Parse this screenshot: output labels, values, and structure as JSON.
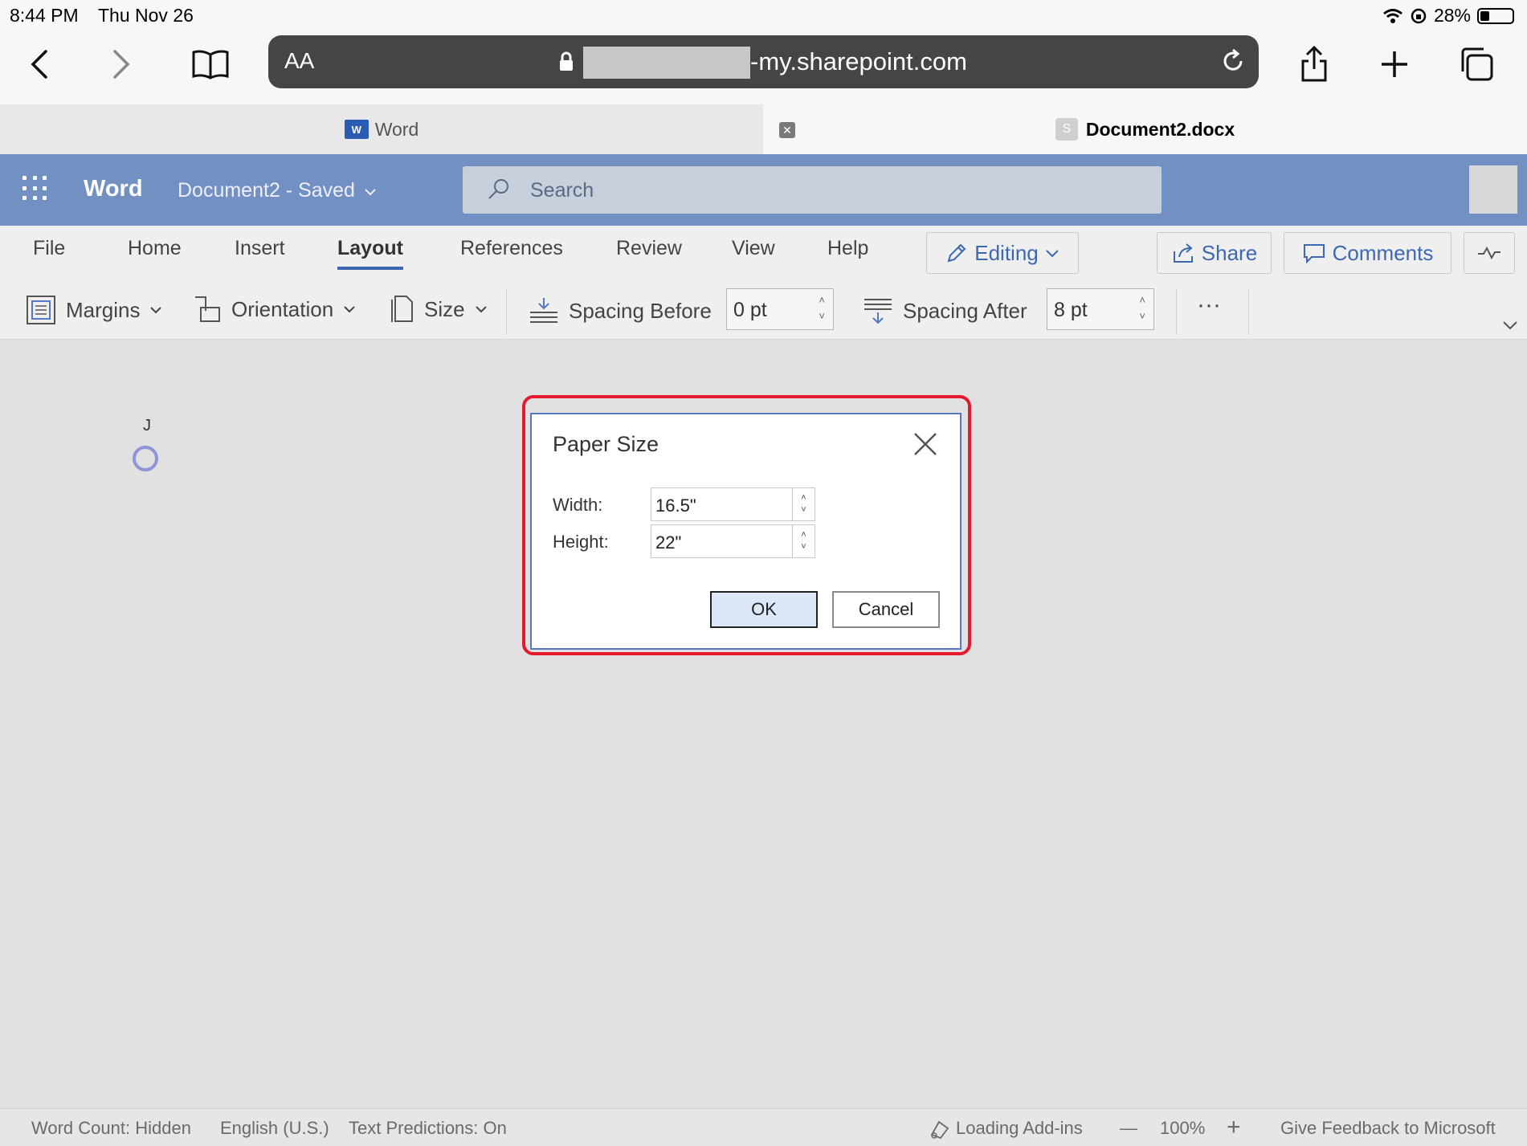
{
  "status_bar": {
    "time": "8:44 PM",
    "date": "Thu Nov 26",
    "battery": "28%"
  },
  "safari": {
    "text_size_label": "AA",
    "url_domain": "-my.sharepoint.com",
    "icons": [
      "back-icon",
      "forward-icon",
      "bookmarks-icon",
      "lock-icon",
      "reload-icon",
      "share-icon",
      "new-tab-icon",
      "tabs-icon"
    ]
  },
  "browser_tabs": [
    {
      "label": "Word",
      "active": false
    },
    {
      "label": "Document2.docx",
      "active": true
    }
  ],
  "word_header": {
    "app_name": "Word",
    "doc_title": "Document2  -  Saved",
    "search_placeholder": "Search"
  },
  "ribbon_tabs": [
    "File",
    "Home",
    "Insert",
    "Layout",
    "References",
    "Review",
    "View",
    "Help"
  ],
  "ribbon_active_tab": "Layout",
  "ribbon_actions": {
    "editing": "Editing",
    "share": "Share",
    "comments": "Comments"
  },
  "ribbon_commands": {
    "margins": "Margins",
    "orientation": "Orientation",
    "size": "Size",
    "spacing_before_label": "Spacing Before",
    "spacing_before_value": "0 pt",
    "spacing_after_label": "Spacing After",
    "spacing_after_value": "8 pt",
    "more": "···"
  },
  "canvas": {
    "cursor_label": "J"
  },
  "dialog": {
    "title": "Paper Size",
    "width_label": "Width:",
    "width_value": "16.5\"",
    "height_label": "Height:",
    "height_value": "22\"",
    "ok_label": "OK",
    "cancel_label": "Cancel"
  },
  "footer": {
    "word_count": "Word Count: Hidden",
    "language": "English (U.S.)",
    "text_predictions": "Text Predictions: On",
    "addins": "Loading Add-ins",
    "zoom_minus": "—",
    "zoom": "100%",
    "zoom_plus": "+",
    "feedback": "Give Feedback to Microsoft"
  },
  "colors": {
    "word_blue": "#7390c3",
    "accent": "#3d68b1",
    "highlight_red": "#e51a2d"
  }
}
